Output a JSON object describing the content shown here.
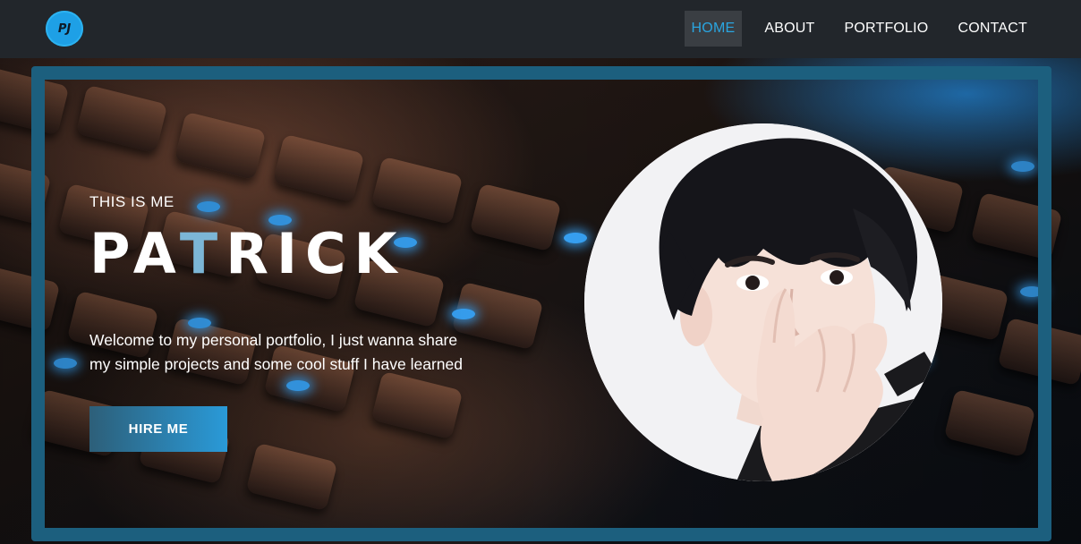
{
  "logo": {
    "text": "PJ"
  },
  "nav": {
    "items": [
      {
        "label": "HOME",
        "active": true
      },
      {
        "label": "ABOUT",
        "active": false
      },
      {
        "label": "PORTFOLIO",
        "active": false
      },
      {
        "label": "CONTACT",
        "active": false
      }
    ]
  },
  "hero": {
    "eyebrow": "THIS IS ME",
    "name_part1": "PA",
    "name_accent": "T",
    "name_part2": "RICK",
    "intro_line1": "Welcome to my personal portfolio, I just wanna share",
    "intro_line2": "my simple projects and some cool stuff I have learned",
    "cta_label": "HIRE ME"
  },
  "colors": {
    "accent": "#2aa5e0",
    "frame": "#1c5f7e",
    "navbar": "#22262b",
    "nav_active_bg": "#3a3e43"
  }
}
